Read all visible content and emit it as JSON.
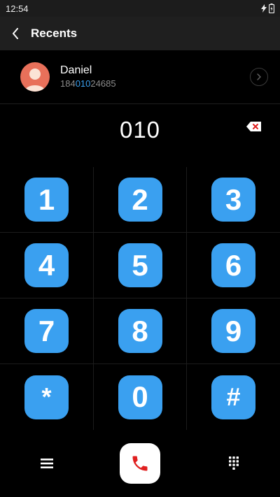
{
  "status_bar": {
    "time": "12:54"
  },
  "app_bar": {
    "title": "Recents"
  },
  "contact": {
    "name": "Daniel",
    "number_prefix": "184",
    "number_match": "010",
    "number_suffix": "24685"
  },
  "dial": {
    "value": "010"
  },
  "keypad": {
    "keys": [
      "1",
      "2",
      "3",
      "4",
      "5",
      "6",
      "7",
      "8",
      "9",
      "*",
      "0",
      "#"
    ]
  },
  "colors": {
    "accent": "#3aa0f0",
    "avatar": "#e8705a",
    "call_icon": "#e02020"
  }
}
